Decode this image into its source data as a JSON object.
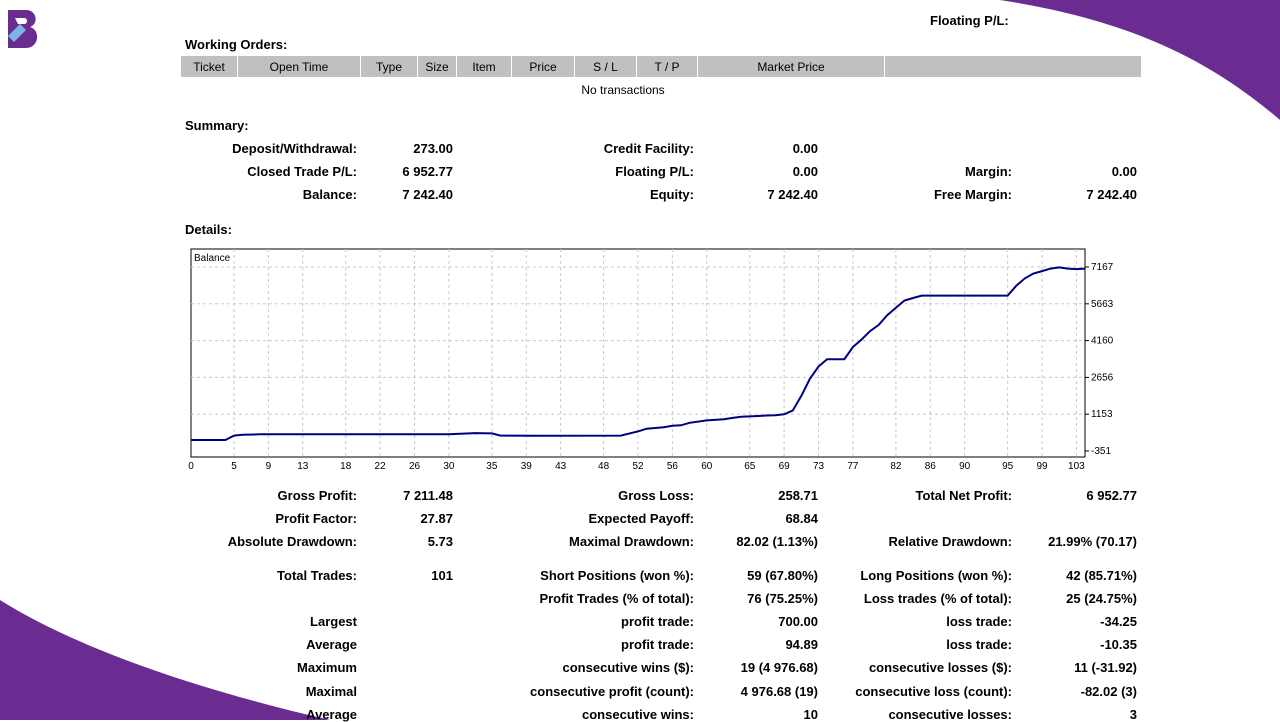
{
  "top": {
    "floating_label": "Floating P/L:"
  },
  "working_orders": {
    "title": "Working Orders:",
    "columns": [
      "Ticket",
      "Open Time",
      "Type",
      "Size",
      "Item",
      "Price",
      "S / L",
      "T / P",
      "Market Price",
      ""
    ],
    "empty_text": "No transactions"
  },
  "summary": {
    "title": "Summary:",
    "rows": [
      [
        {
          "label": "Deposit/Withdrawal:",
          "value": "273.00"
        },
        {
          "label": "Credit Facility:",
          "value": "0.00"
        },
        {
          "label": "",
          "value": ""
        }
      ],
      [
        {
          "label": "Closed Trade P/L:",
          "value": "6 952.77"
        },
        {
          "label": "Floating P/L:",
          "value": "0.00"
        },
        {
          "label": "Margin:",
          "value": "0.00"
        }
      ],
      [
        {
          "label": "Balance:",
          "value": "7 242.40"
        },
        {
          "label": "Equity:",
          "value": "7 242.40"
        },
        {
          "label": "Free Margin:",
          "value": "7 242.40"
        }
      ]
    ]
  },
  "details": {
    "title": "Details:"
  },
  "chart_data": {
    "type": "line",
    "title": "Balance",
    "x_ticks": [
      "0",
      "5",
      "9",
      "13",
      "18",
      "22",
      "26",
      "30",
      "35",
      "39",
      "43",
      "48",
      "52",
      "56",
      "60",
      "65",
      "69",
      "73",
      "77",
      "82",
      "86",
      "90",
      "95",
      "99",
      "103"
    ],
    "y_ticks": [
      "7167",
      "5663",
      "4160",
      "2656",
      "1153",
      "-351"
    ],
    "ylim": [
      -351,
      7167
    ],
    "xlim": [
      0,
      104
    ],
    "grid": true,
    "series": [
      {
        "color": "#000080",
        "x": [
          0,
          4,
          5,
          6,
          8,
          30,
          33,
          35,
          36,
          40,
          50,
          52,
          53,
          55,
          56,
          57,
          58,
          60,
          62,
          63,
          64,
          66,
          67,
          68,
          69,
          70,
          71,
          72,
          73,
          74,
          76,
          77,
          78,
          79,
          80,
          81,
          82,
          83,
          84,
          85,
          86,
          90,
          94,
          95,
          96,
          97,
          98,
          99,
          100,
          101,
          102,
          103,
          104
        ],
        "y": [
          100,
          100,
          280,
          310,
          330,
          330,
          380,
          370,
          280,
          270,
          280,
          450,
          560,
          620,
          680,
          700,
          800,
          900,
          950,
          1000,
          1050,
          1080,
          1100,
          1110,
          1150,
          1300,
          1900,
          2600,
          3100,
          3400,
          3400,
          3900,
          4200,
          4550,
          4800,
          5200,
          5500,
          5800,
          5900,
          6000,
          6000,
          6000,
          6000,
          6000,
          6400,
          6700,
          6900,
          7000,
          7100,
          7150,
          7100,
          7080,
          7100
        ]
      }
    ]
  },
  "stats": {
    "rows": [
      [
        {
          "label": "Gross Profit:",
          "value": "7 211.48"
        },
        {
          "label": "Gross Loss:",
          "value": "258.71"
        },
        {
          "label": "Total Net Profit:",
          "value": "6 952.77"
        }
      ],
      [
        {
          "label": "Profit Factor:",
          "value": "27.87"
        },
        {
          "label": "Expected Payoff:",
          "value": "68.84"
        },
        {
          "label": "",
          "value": ""
        }
      ],
      [
        {
          "label": "Absolute Drawdown:",
          "value": "5.73"
        },
        {
          "label": "Maximal Drawdown:",
          "value": "82.02 (1.13%)"
        },
        {
          "label": "Relative Drawdown:",
          "value": "21.99% (70.17)"
        }
      ],
      [
        {
          "label": "Total Trades:",
          "value": "101"
        },
        {
          "label": "Short Positions (won %):",
          "value": "59 (67.80%)"
        },
        {
          "label": "Long Positions (won %):",
          "value": "42 (85.71%)"
        }
      ],
      [
        {
          "label": "",
          "value": ""
        },
        {
          "label": "Profit Trades (% of total):",
          "value": "76 (75.25%)"
        },
        {
          "label": "Loss trades (% of total):",
          "value": "25 (24.75%)"
        }
      ],
      [
        {
          "label": "Largest",
          "value": ""
        },
        {
          "label": "profit trade:",
          "value": "700.00"
        },
        {
          "label": "loss trade:",
          "value": "-34.25"
        }
      ],
      [
        {
          "label": "Average",
          "value": ""
        },
        {
          "label": "profit trade:",
          "value": "94.89"
        },
        {
          "label": "loss trade:",
          "value": "-10.35"
        }
      ],
      [
        {
          "label": "Maximum",
          "value": ""
        },
        {
          "label": "consecutive wins ($):",
          "value": "19 (4 976.68)"
        },
        {
          "label": "consecutive losses ($):",
          "value": "11 (-31.92)"
        }
      ],
      [
        {
          "label": "Maximal",
          "value": ""
        },
        {
          "label": "consecutive profit (count):",
          "value": "4 976.68 (19)"
        },
        {
          "label": "consecutive loss (count):",
          "value": "-82.02 (3)"
        }
      ],
      [
        {
          "label": "Average",
          "value": ""
        },
        {
          "label": "consecutive wins:",
          "value": "10"
        },
        {
          "label": "consecutive losses:",
          "value": "3"
        }
      ]
    ]
  },
  "colors": {
    "accent_purple": "#6a2c91",
    "line": "#000080",
    "header_gray": "#c0c0c0",
    "grid": "#c8c8c8"
  }
}
